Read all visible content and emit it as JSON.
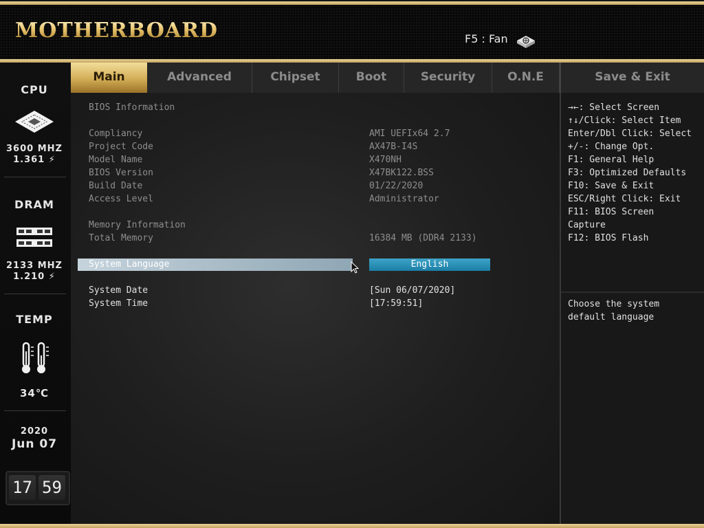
{
  "header": {
    "logo": "MOTHERBOARD",
    "fan_hint": "F5 : Fan"
  },
  "sidebar": {
    "cpu": {
      "title": "CPU",
      "freq": "3600 MHZ",
      "volt": "1.361 ⚡"
    },
    "dram": {
      "title": "DRAM",
      "freq": "2133 MHZ",
      "volt": "1.210 ⚡"
    },
    "temp": {
      "title": "TEMP",
      "value": "34℃"
    },
    "date": {
      "year": "2020",
      "day": "Jun 07"
    },
    "clock": {
      "hours": "17",
      "minutes": "59"
    }
  },
  "tabs": [
    {
      "label": "Main"
    },
    {
      "label": "Advanced"
    },
    {
      "label": "Chipset"
    },
    {
      "label": "Boot"
    },
    {
      "label": "Security"
    },
    {
      "label": "O.N.E"
    },
    {
      "label": "Save & Exit"
    }
  ],
  "main": {
    "bios_info_heading": "BIOS Information",
    "rows": [
      {
        "label": "Compliancy",
        "value": "AMI UEFIx64 2.7"
      },
      {
        "label": "Project Code",
        "value": "AX47B-I4S"
      },
      {
        "label": "Model Name",
        "value": "X470NH"
      },
      {
        "label": "BIOS Version",
        "value": "X47BK122.BSS"
      },
      {
        "label": "Build Date",
        "value": "01/22/2020"
      },
      {
        "label": "Access Level",
        "value": "Administrator"
      }
    ],
    "memory_heading": "Memory Information",
    "memory": {
      "label": "Total Memory",
      "value": "16384 MB (DDR4 2133)"
    },
    "language": {
      "label": "System Language",
      "value": "English"
    },
    "date": {
      "label": "System Date",
      "value": "[Sun 06/07/2020]"
    },
    "time": {
      "label": "System Time",
      "value": "[17:59:51]"
    }
  },
  "help": {
    "lines": [
      "→←: Select Screen",
      "↑↓/Click: Select Item",
      "Enter/Dbl Click: Select",
      "+/-: Change Opt.",
      "F1: General Help",
      "F3: Optimized Defaults",
      "F10: Save & Exit",
      "ESC/Right Click: Exit",
      "F11: BIOS Screen",
      "Capture",
      "F12: BIOS Flash"
    ],
    "description": "Choose the system default language"
  }
}
